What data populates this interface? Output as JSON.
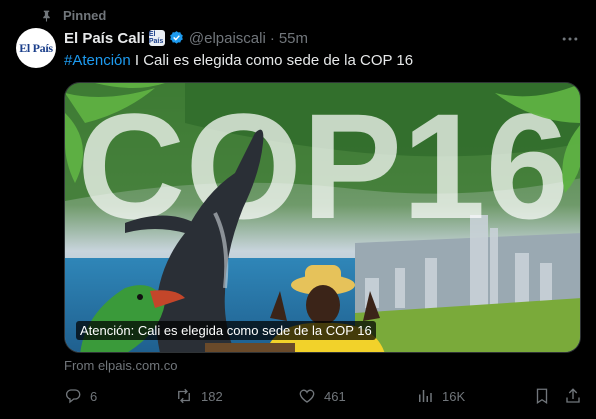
{
  "pinned": {
    "label": "Pinned"
  },
  "author": {
    "avatar_text": "El País",
    "name": "El País Cali",
    "affiliate_badge": "El País",
    "handle": "@elpaiscali",
    "separator": "·",
    "time": "55m"
  },
  "tweet": {
    "hashtag": "#Atención",
    "text": " I Cali es elegida como sede de la COP 16"
  },
  "media": {
    "big_text": "COP16",
    "caption": "Atención: Cali es elegida como sede de la COP 16",
    "source": "From elpais.com.co"
  },
  "actions": {
    "replies": "6",
    "reposts": "182",
    "likes": "461",
    "views": "16K"
  },
  "colors": {
    "accent": "#1d9bf0",
    "muted": "#71767b",
    "bg": "#000000"
  },
  "icons": [
    "pin-icon",
    "verified-icon",
    "more-icon",
    "reply-icon",
    "repost-icon",
    "like-icon",
    "views-icon",
    "bookmark-icon",
    "share-icon"
  ]
}
